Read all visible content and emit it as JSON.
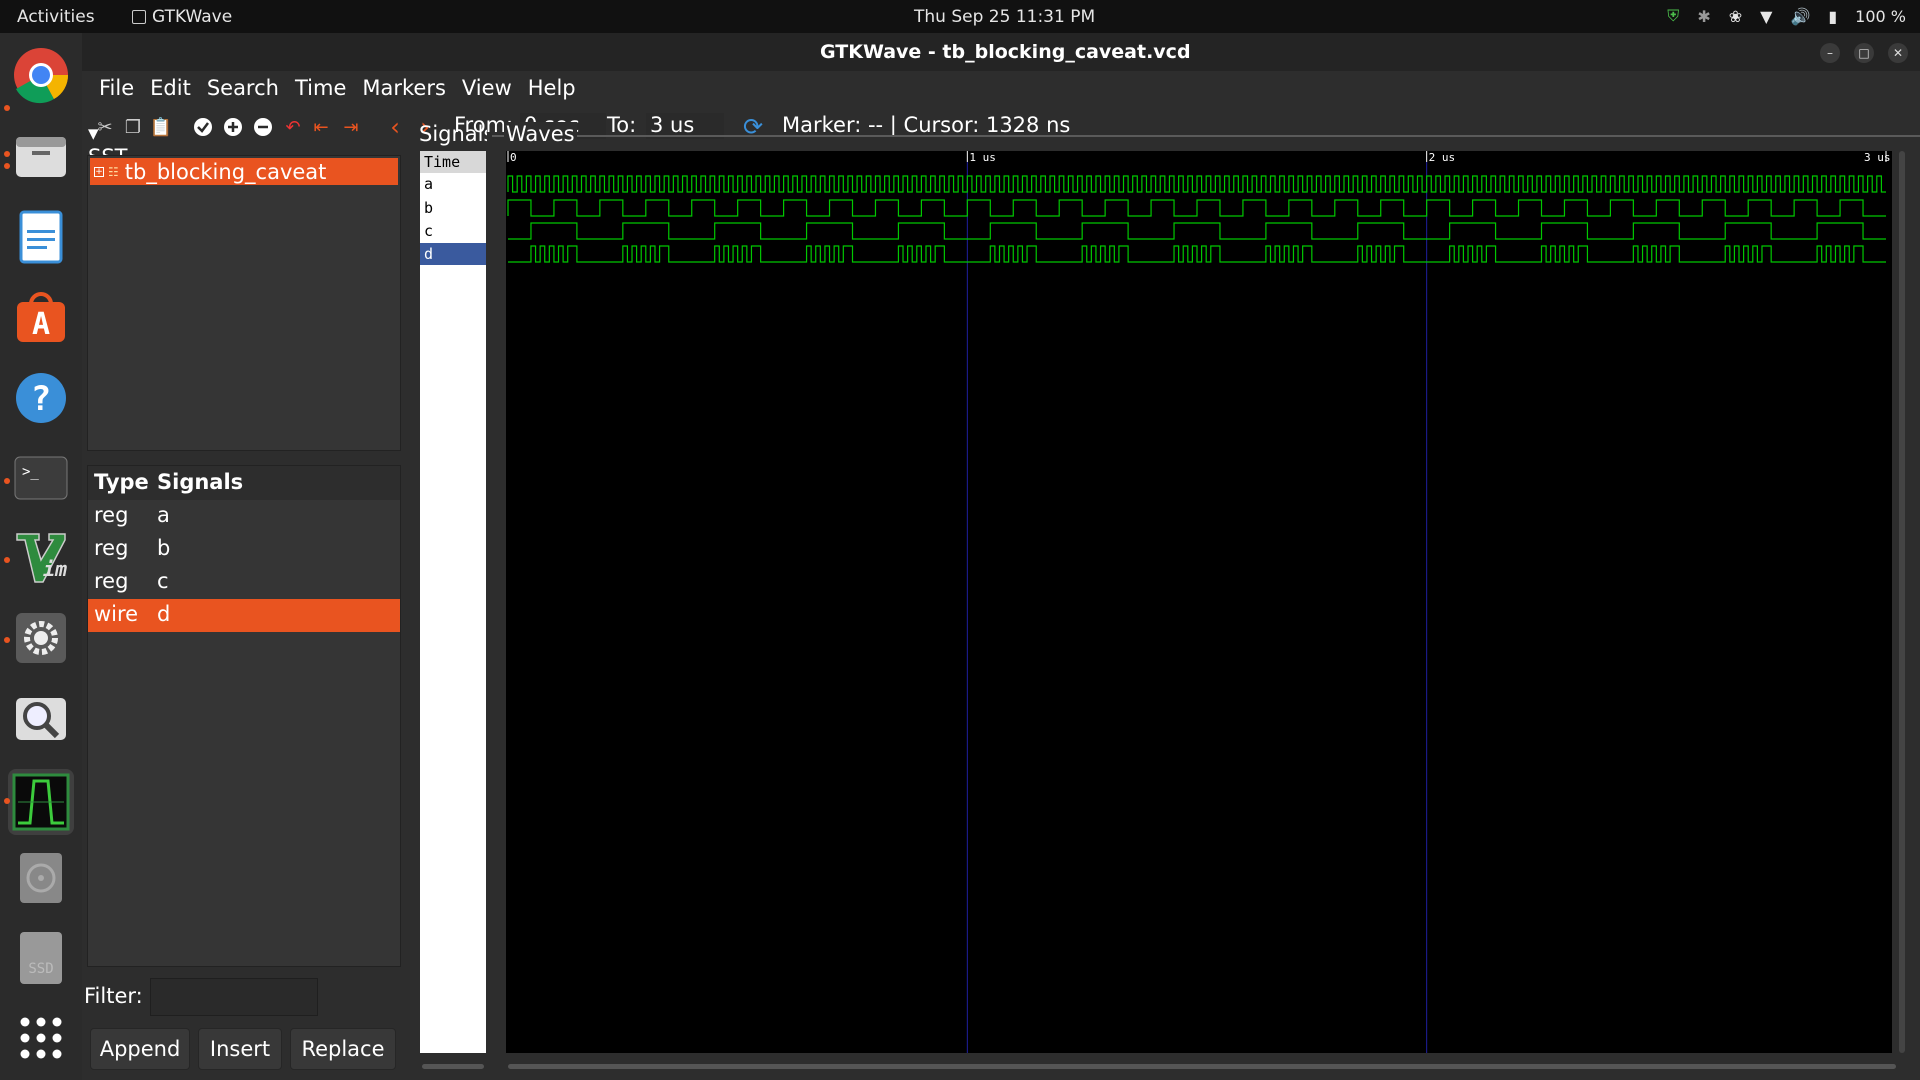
{
  "topbar": {
    "activities": "Activities",
    "app_name": "GTKWave",
    "clock": "Thu Sep 25  11:31 PM",
    "battery": "100 %"
  },
  "window": {
    "title": "GTKWave - tb_blocking_caveat.vcd"
  },
  "menu": [
    "File",
    "Edit",
    "Search",
    "Time",
    "Markers",
    "View",
    "Help"
  ],
  "toolbar": {
    "from_label": "From:",
    "from_value": "0 sec",
    "to_label": "To:",
    "to_value": "3 us",
    "marker_text": "Marker: --  |  Cursor: 1328 ns"
  },
  "sst": {
    "header": "SST",
    "root": "tb_blocking_caveat"
  },
  "signal_list": {
    "col_type": "Type",
    "col_signals": "Signals",
    "rows": [
      {
        "type": "reg",
        "name": "a",
        "selected": false
      },
      {
        "type": "reg",
        "name": "b",
        "selected": false
      },
      {
        "type": "reg",
        "name": "c",
        "selected": false
      },
      {
        "type": "wire",
        "name": "d",
        "selected": true
      }
    ]
  },
  "filter": {
    "label": "Filter:",
    "value": ""
  },
  "buttons": {
    "append": "Append",
    "insert": "Insert",
    "replace": "Replace"
  },
  "signals_pane": {
    "header": "Signals",
    "rows": [
      "Time",
      "a",
      "b",
      "c",
      "d"
    ],
    "selected": "d"
  },
  "waves": {
    "header": "Waves",
    "ticks": [
      {
        "t_ns": 0,
        "label": "0"
      },
      {
        "t_ns": 1000,
        "label": "1 us"
      },
      {
        "t_ns": 2000,
        "label": "2 us"
      },
      {
        "t_ns": 3000,
        "label": "3 us"
      }
    ],
    "range_ns": [
      0,
      3000
    ],
    "wave_color": "#00c800",
    "grid_color": "#2020a0",
    "a_period_ns": 20,
    "b_period_ns": 100,
    "c_period_ns": 200
  },
  "colors": {
    "accent": "#e95420",
    "selection_blue": "#3a5a9e"
  }
}
